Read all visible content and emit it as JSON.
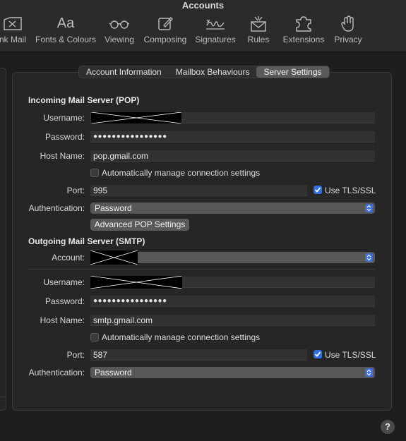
{
  "window": {
    "title": "Accounts"
  },
  "toolbar": [
    {
      "id": "junk",
      "label": "nk Mail",
      "icon": "junk-mail-icon"
    },
    {
      "id": "fonts",
      "label": "Fonts & Colours",
      "icon": "fonts-icon",
      "glyph": "Aa"
    },
    {
      "id": "viewing",
      "label": "Viewing",
      "icon": "glasses-icon"
    },
    {
      "id": "composing",
      "label": "Composing",
      "icon": "compose-icon"
    },
    {
      "id": "signatures",
      "label": "Signatures",
      "icon": "signature-icon"
    },
    {
      "id": "rules",
      "label": "Rules",
      "icon": "rules-icon"
    },
    {
      "id": "extensions",
      "label": "Extensions",
      "icon": "puzzle-icon"
    },
    {
      "id": "privacy",
      "label": "Privacy",
      "icon": "hand-icon"
    }
  ],
  "tabs": [
    {
      "label": "Account Information",
      "active": false
    },
    {
      "label": "Mailbox Behaviours",
      "active": false
    },
    {
      "label": "Server Settings",
      "active": true
    }
  ],
  "incoming": {
    "title": "Incoming Mail Server (POP)",
    "username_label": "Username:",
    "username_value": "",
    "password_label": "Password:",
    "password_value": "●●●●●●●●●●●●●●●●",
    "host_label": "Host Name:",
    "host_value": "pop.gmail.com",
    "auto_manage_label": "Automatically manage connection settings",
    "auto_manage_checked": false,
    "port_label": "Port:",
    "port_value": "995",
    "tls_label": "Use TLS/SSL",
    "tls_checked": true,
    "auth_label": "Authentication:",
    "auth_value": "Password",
    "advanced_button": "Advanced POP Settings"
  },
  "outgoing": {
    "title": "Outgoing Mail Server (SMTP)",
    "account_label": "Account:",
    "account_value": "",
    "username_label": "Username:",
    "username_value": "",
    "password_label": "Password:",
    "password_value": "●●●●●●●●●●●●●●●●",
    "host_label": "Host Name:",
    "host_value": "smtp.gmail.com",
    "auto_manage_label": "Automatically manage connection settings",
    "auto_manage_checked": false,
    "port_label": "Port:",
    "port_value": "587",
    "tls_label": "Use TLS/SSL",
    "tls_checked": true,
    "auth_label": "Authentication:",
    "auth_value": "Password"
  },
  "help": {
    "label": "?"
  },
  "colors": {
    "accent": "#2f6ee3",
    "background": "#1e1e1e",
    "panel": "#262626"
  }
}
